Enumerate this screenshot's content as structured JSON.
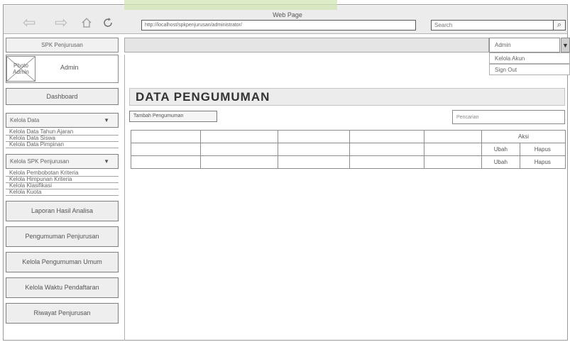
{
  "window": {
    "title": "Web Page"
  },
  "browser": {
    "url": "http://localhost/spkpenjurusan/administrator/",
    "search_placeholder": "Search",
    "back_icon": "back-arrow-icon",
    "forward_icon": "forward-arrow-icon",
    "home_icon": "home-icon",
    "refresh_icon": "refresh-icon"
  },
  "sidebar": {
    "brand": "SPK Penjurusan",
    "photo_label": "Photo Admin",
    "user_name": "Admin",
    "dashboard": "Dashboard",
    "kelola_data": {
      "label": "Kelola Data",
      "items": [
        "Kelola Data Tahun Ajaran",
        "Kelola Data Siswa",
        "Kelola Data Pimpinan"
      ]
    },
    "kelola_spk": {
      "label": "Kelola SPK Penjurusan",
      "items": [
        "Kelola Pembobotan Kriteria",
        "Kelola Himpunan Kriteria",
        "Kelola Klasifikasi",
        "Kelola Kuota"
      ]
    },
    "buttons": [
      "Laporan Hasil Analisa",
      "Pengumuman Penjurusan",
      "Kelola Pengumuman Umum",
      "Kelola Waktu Pendaftaran",
      "Riwayat Penjurusan"
    ]
  },
  "header": {
    "admin_label": "Admin",
    "menu": [
      "Kelola Akun",
      "Sign Out"
    ]
  },
  "main": {
    "title": "DATA PENGUMUMAN",
    "add_button": "Tambah Pengumuman",
    "search_placeholder": "Pencarian",
    "table": {
      "action_header": "Aksi",
      "rows": [
        {
          "edit": "Ubah",
          "delete": "Hapus"
        },
        {
          "edit": "Ubah",
          "delete": "Hapus"
        }
      ]
    }
  }
}
